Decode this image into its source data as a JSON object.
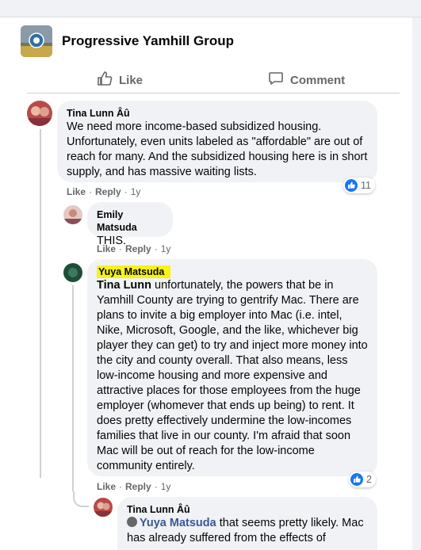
{
  "group": {
    "name": "Progressive Yamhill Group"
  },
  "actions": {
    "like_label": "Like",
    "comment_label": "Comment"
  },
  "comments": [
    {
      "author": "Tina Lunn Âû",
      "text": "We need more income-based subsidized housing. Unfortunately, even units labeled as \"affordable\" are out of reach for many. And the subsidized housing here is in short supply, and has massive waiting lists.",
      "like": "Like",
      "reply": "Reply",
      "time": "1y",
      "reactions": "11"
    },
    {
      "author": "Emily Matsuda",
      "text": "THIS.",
      "like": "Like",
      "reply": "Reply",
      "time": "1y"
    },
    {
      "author": "Yuya Matsuda",
      "mention": "Tina Lunn",
      "text": " unfortunately, the powers that be in Yamhill County are trying to gentrify Mac. There are plans to invite a big employer into Mac (i.e. intel, Nike, Microsoft, Google, and the like, whichever big player they can get) to try and inject more money into the city and county overall. That also means, less low-income housing and more expensive and attractive places for those employees from the huge employer (whomever that ends up being) to rent. It does pretty effectively undermine the low-incomes families that live in our county. I'm afraid that soon Mac will be out of reach for the low-income community entirely.",
      "like": "Like",
      "reply": "Reply",
      "time": "1y",
      "reactions": "2"
    },
    {
      "author": "Tina Lunn Âû",
      "mention": "Yuya Matsuda",
      "text": " that seems pretty likely. Mac has already suffered from the effects of"
    }
  ]
}
